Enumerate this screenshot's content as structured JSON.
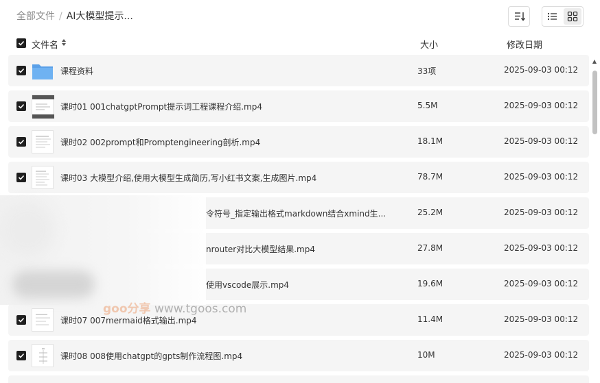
{
  "breadcrumb": {
    "root": "全部文件",
    "separator": "/",
    "current": "AI大模型提示..."
  },
  "toolbar": {
    "sort_icon": "sort-icon",
    "list_view_icon": "list-view-icon",
    "grid_view_icon": "grid-view-icon",
    "active_view": "list"
  },
  "columns": {
    "name": "文件名",
    "size": "大小",
    "date": "修改日期"
  },
  "files": [
    {
      "name": "课程资料",
      "size": "33项",
      "date": "2025-09-03 00:12",
      "type": "folder",
      "checked": true
    },
    {
      "name": "课时01 001chatgptPrompt提示词工程课程介绍.mp4",
      "size": "5.5M",
      "date": "2025-09-03 00:12",
      "type": "video",
      "checked": true
    },
    {
      "name": "课时02 002prompt和Promptengineering剖析.mp4",
      "size": "18.1M",
      "date": "2025-09-03 00:12",
      "type": "video",
      "checked": true
    },
    {
      "name": "课时03 大模型介绍,使用大模型生成简历,写小红书文案,生成图片.mp4",
      "size": "78.7M",
      "date": "2025-09-03 00:12",
      "type": "video",
      "checked": true
    },
    {
      "name": "令符号_指定输出格式markdown结合xmind生...",
      "size": "25.2M",
      "date": "2025-09-03 00:12",
      "type": "video",
      "checked": true
    },
    {
      "name": "nrouter对比大模型结果.mp4",
      "size": "27.8M",
      "date": "2025-09-03 00:12",
      "type": "video",
      "checked": true
    },
    {
      "name": "使用vscode展示.mp4",
      "size": "19.6M",
      "date": "2025-09-03 00:12",
      "type": "video",
      "checked": true
    },
    {
      "name": "课时07 007mermaid格式输出.mp4",
      "size": "11.4M",
      "date": "2025-09-03 00:12",
      "type": "video",
      "checked": true
    },
    {
      "name": "课时08 008使用chatgpt的gpts制作流程图.mp4",
      "size": "10M",
      "date": "2025-09-03 00:12",
      "type": "video",
      "checked": true
    }
  ],
  "watermark": {
    "brand": "goo分享",
    "url": "www.tgoos.com"
  },
  "colors": {
    "row_bg": "#f5f5f5",
    "checkbox": "#1f1f1f",
    "folder": "#5aa0e8"
  }
}
